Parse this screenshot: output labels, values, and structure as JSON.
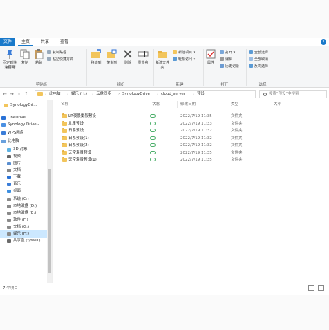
{
  "ribbon_tabs": [
    "文件",
    "主页",
    "共享",
    "查看"
  ],
  "ribbon": {
    "pin_label": "固定到快速访问",
    "copy_label": "复制",
    "paste_label": "粘贴",
    "copy_path_label": "复制路径",
    "paste_shortcut_label": "粘贴快捷方式",
    "cut_label": "剪切",
    "clipboard_group": "剪贴板",
    "move_to_label": "移动到",
    "copy_to_label": "复制到",
    "delete_label": "删除",
    "rename_label": "重命名",
    "organize_group": "组织",
    "new_folder_label": "新建文件夹",
    "new_item_label": "新建项目",
    "easy_access_label": "轻松访问",
    "new_group": "新建",
    "properties_label": "属性",
    "open_label": "打开",
    "edit_label": "编辑",
    "history_label": "历史记录",
    "open_group": "打开",
    "select_all_label": "全部选择",
    "select_none_label": "全部取消",
    "invert_selection_label": "反向选择",
    "select_group": "选择"
  },
  "nav": {
    "back": "←",
    "forward": "→",
    "recent": "⌄",
    "up": "↑",
    "breadcrumbs": [
      "此电脑",
      "娱乐 (H:)",
      "云盘同步",
      "SynologyDrive",
      "cloud_server",
      "预设"
    ],
    "search_placeholder": "搜索\"预设\"中搜索"
  },
  "sidebar": {
    "items": [
      {
        "label": "SynologyDri...",
        "icon": "folder-icon",
        "selected": false
      },
      {
        "label": "OneDrive",
        "icon": "onedrive-icon",
        "selected": false
      },
      {
        "label": "Synology Drive -",
        "icon": "synology-drive-icon",
        "selected": false
      },
      {
        "label": "WPS网盘",
        "icon": "wps-cloud-icon",
        "selected": false
      },
      {
        "label": "此电脑",
        "icon": "computer-icon",
        "selected": false
      },
      {
        "label": "3D 对象",
        "icon": "3d-objects-icon",
        "selected": false
      },
      {
        "label": "视频",
        "icon": "videos-icon",
        "selected": false
      },
      {
        "label": "图片",
        "icon": "pictures-icon",
        "selected": false
      },
      {
        "label": "文档",
        "icon": "documents-icon",
        "selected": false
      },
      {
        "label": "下载",
        "icon": "downloads-icon",
        "selected": false
      },
      {
        "label": "音乐",
        "icon": "music-icon",
        "selected": false
      },
      {
        "label": "桌面",
        "icon": "desktop-icon",
        "selected": false
      },
      {
        "label": "系统 (C:)",
        "icon": "drive-icon",
        "selected": false
      },
      {
        "label": "本地磁盘 (D:)",
        "icon": "drive-icon",
        "selected": false
      },
      {
        "label": "本地磁盘 (E:)",
        "icon": "drive-icon",
        "selected": false
      },
      {
        "label": "软件 (F:)",
        "icon": "drive-icon",
        "selected": false
      },
      {
        "label": "文档 (G:)",
        "icon": "drive-icon",
        "selected": false
      },
      {
        "label": "娱乐 (H:)",
        "icon": "drive-icon",
        "selected": true
      },
      {
        "label": "共享盘 (\\\\nas1)",
        "icon": "network-drive-icon",
        "selected": false
      }
    ]
  },
  "columns": {
    "name": "名称",
    "status": "状态",
    "date": "修改日期",
    "type": "类型",
    "size": "大小"
  },
  "files": [
    {
      "name": "LR夜景摄影预设",
      "date": "2022/7/19 11:35",
      "type": "文件夹"
    },
    {
      "name": "儿童预设",
      "date": "2022/7/19 11:33",
      "type": "文件夹"
    },
    {
      "name": "日系预设",
      "date": "2022/7/19 11:32",
      "type": "文件夹"
    },
    {
      "name": "日系预设(1)",
      "date": "2022/7/19 11:32",
      "type": "文件夹"
    },
    {
      "name": "日系预设(2)",
      "date": "2022/7/19 11:32",
      "type": "文件夹"
    },
    {
      "name": "天空海景预设",
      "date": "2022/7/19 11:35",
      "type": "文件夹"
    },
    {
      "name": "天空海景预设(1)",
      "date": "2022/7/19 11:35",
      "type": "文件夹"
    }
  ],
  "status": {
    "count": "7 个项目"
  }
}
